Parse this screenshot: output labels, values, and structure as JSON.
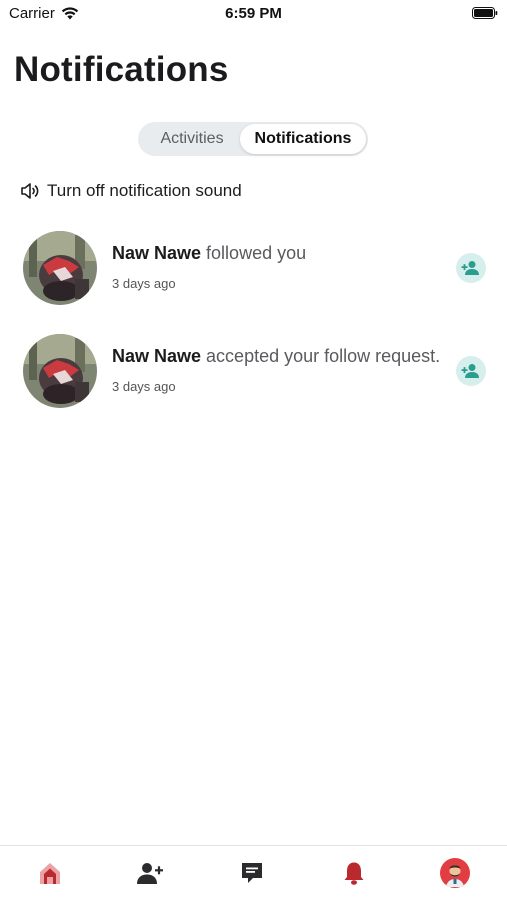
{
  "status_bar": {
    "carrier": "Carrier",
    "time": "6:59 PM"
  },
  "page": {
    "title": "Notifications"
  },
  "segments": {
    "activities": "Activities",
    "notifications": "Notifications",
    "selected": "notifications"
  },
  "sound_toggle": {
    "label": "Turn off notification sound",
    "icon": "speaker-icon"
  },
  "notifications": [
    {
      "name": "Naw Nawe",
      "action": " followed you",
      "time": "3 days ago",
      "icon": "person-add-icon"
    },
    {
      "name": "Naw Nawe",
      "action": " accepted your follow request.",
      "time": "3 days ago",
      "icon": "person-add-icon"
    }
  ],
  "tab_bar": {
    "items": [
      {
        "icon": "home-icon",
        "active": true
      },
      {
        "icon": "add-friend-icon"
      },
      {
        "icon": "chat-icon"
      },
      {
        "icon": "bell-icon"
      },
      {
        "icon": "profile-avatar"
      }
    ]
  },
  "colors": {
    "accent_red": "#b9292e",
    "follow_green": "#2a9d8f",
    "follow_bg": "#d7efec",
    "segment_bg": "#e9ecef"
  }
}
